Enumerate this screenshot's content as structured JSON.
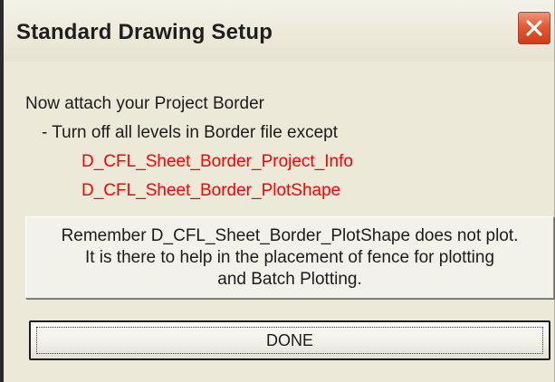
{
  "window": {
    "title": "Standard Drawing Setup",
    "close_icon": "close-x-icon"
  },
  "instructions": {
    "line1": "Now attach your Project Border",
    "line2": "- Turn off all levels in Border file  except",
    "levels": [
      "D_CFL_Sheet_Border_Project_Info",
      "D_CFL_Sheet_Border_PlotShape"
    ]
  },
  "note": {
    "lines": [
      "Remember D_CFL_Sheet_Border_PlotShape does not plot.",
      "It is there to help in the placement of fence for plotting",
      "and Batch Plotting."
    ]
  },
  "done_button": {
    "label": "DONE"
  },
  "colors": {
    "highlight_text": "#ff0000",
    "dialog_background": "#ece9d8",
    "close_button": "#e35a36"
  }
}
